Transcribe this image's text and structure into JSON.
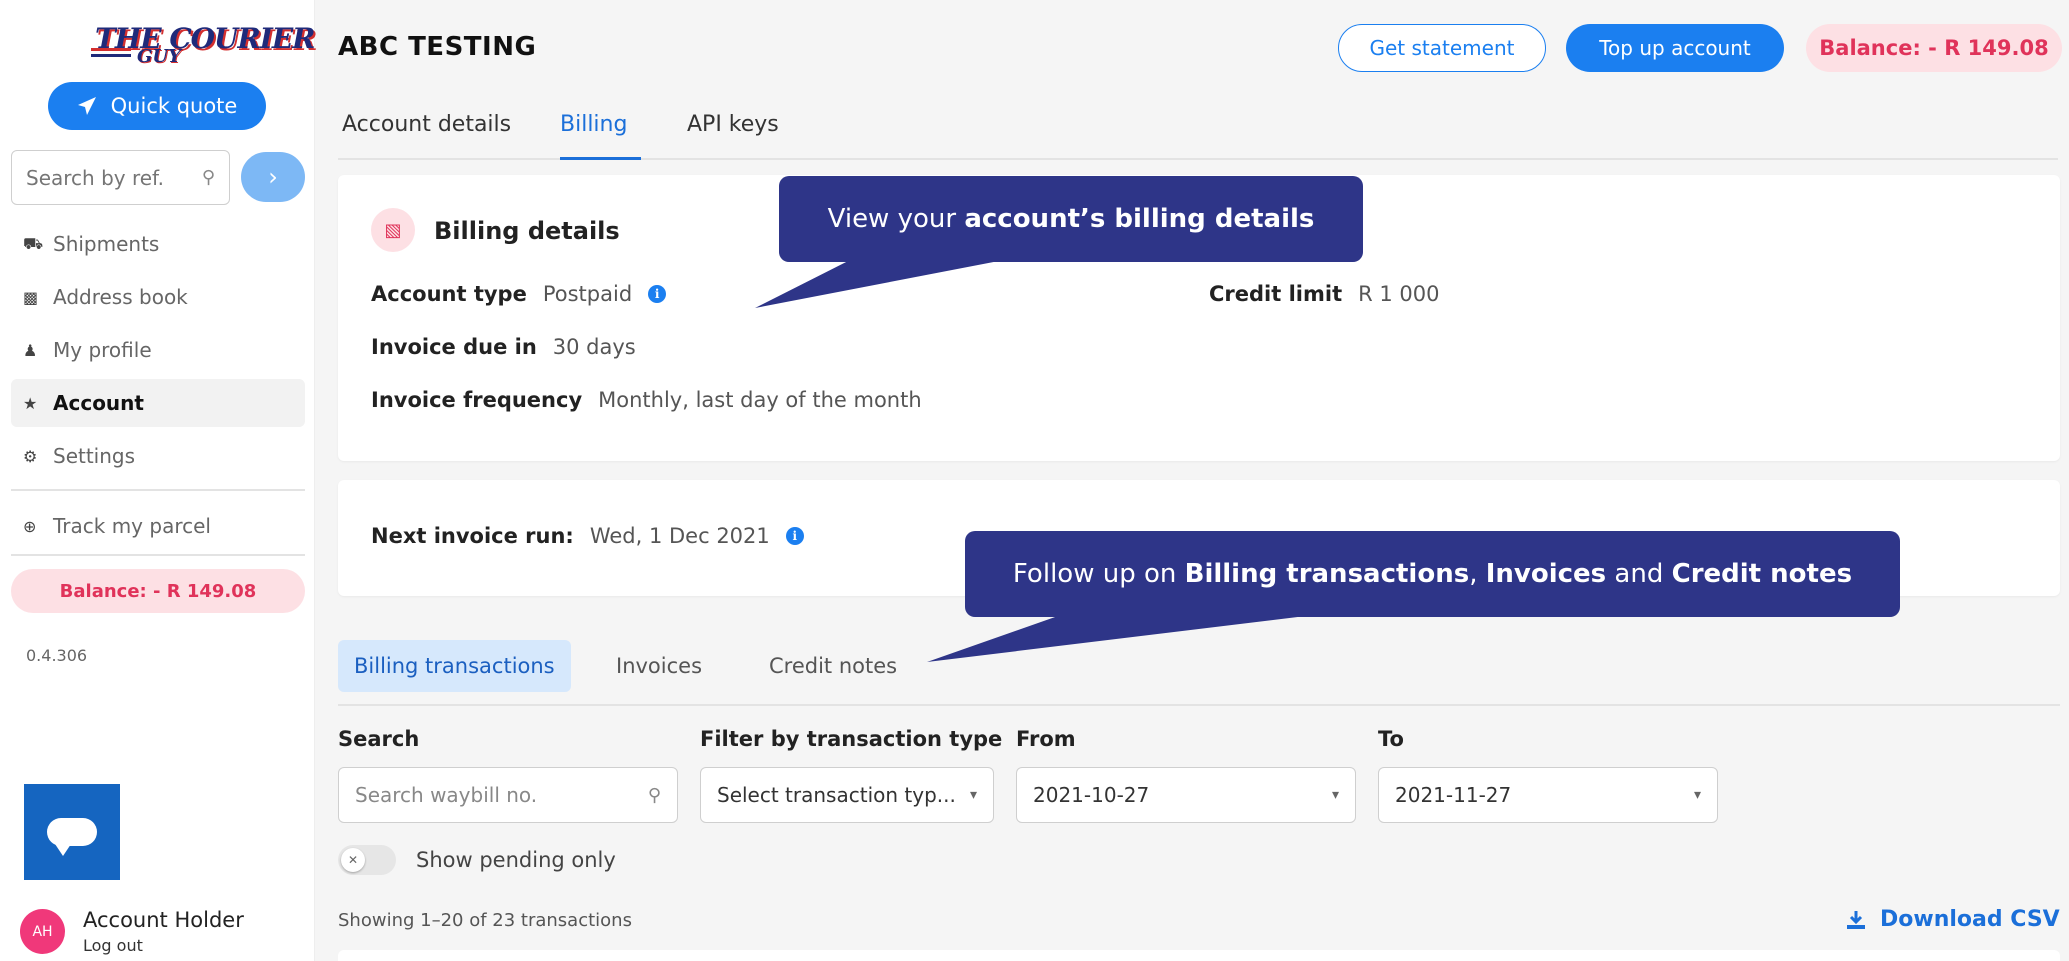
{
  "sidebar": {
    "logo_text_top": "THE COURIER",
    "logo_text_bottom": "GUY",
    "quick_quote_label": "Quick quote",
    "search_placeholder": "Search by ref.",
    "nav": [
      {
        "label": "Shipments",
        "icon": "truck-icon"
      },
      {
        "label": "Address book",
        "icon": "address-book-icon"
      },
      {
        "label": "My profile",
        "icon": "user-icon"
      },
      {
        "label": "Account",
        "icon": "star-icon",
        "active": true
      },
      {
        "label": "Settings",
        "icon": "gear-icon"
      }
    ],
    "track_label": "Track my parcel",
    "balance": "Balance: - R 149.08",
    "version": "0.4.306",
    "user": {
      "initials": "AH",
      "name": "Account Holder",
      "logout": "Log out"
    }
  },
  "header": {
    "title": "ABC TESTING",
    "get_statement": "Get statement",
    "top_up": "Top up account",
    "balance": "Balance: - R 149.08"
  },
  "tabs": [
    "Account details",
    "Billing",
    "API keys"
  ],
  "active_tab": "Billing",
  "billing_details": {
    "title": "Billing details",
    "account_type_label": "Account type",
    "account_type_value": "Postpaid",
    "invoice_due_label": "Invoice due in",
    "invoice_due_value": "30 days",
    "invoice_frequency_label": "Invoice frequency",
    "invoice_frequency_value": "Monthly, last day of the month",
    "credit_limit_label": "Credit limit",
    "credit_limit_value": "R 1 000"
  },
  "next_invoice": {
    "label": "Next invoice run:",
    "value": "Wed, 1 Dec 2021"
  },
  "subtabs": [
    "Billing transactions",
    "Invoices",
    "Credit notes"
  ],
  "filters": {
    "search_label": "Search",
    "search_placeholder": "Search waybill no.",
    "type_label": "Filter by transaction type",
    "type_placeholder": "Select transaction typ...",
    "from_label": "From",
    "from_value": "2021-10-27",
    "to_label": "To",
    "to_value": "2021-11-27",
    "pending_label": "Show pending only"
  },
  "showing_text": "Showing 1–20 of 23 transactions",
  "download_csv": "Download CSV",
  "callouts": {
    "one_pre": "View your ",
    "one_bold": "account’s billing details",
    "two_pre": "Follow up on ",
    "two_b1": "Billing transactions",
    "two_sep": ", ",
    "two_b2": "Invoices",
    "two_and": " and ",
    "two_b3": "Credit notes"
  },
  "colors": {
    "primary": "#1b7ff0",
    "balance_bg": "#fde0e4",
    "balance_text": "#e0335a",
    "callout_bg": "#2e3588"
  }
}
